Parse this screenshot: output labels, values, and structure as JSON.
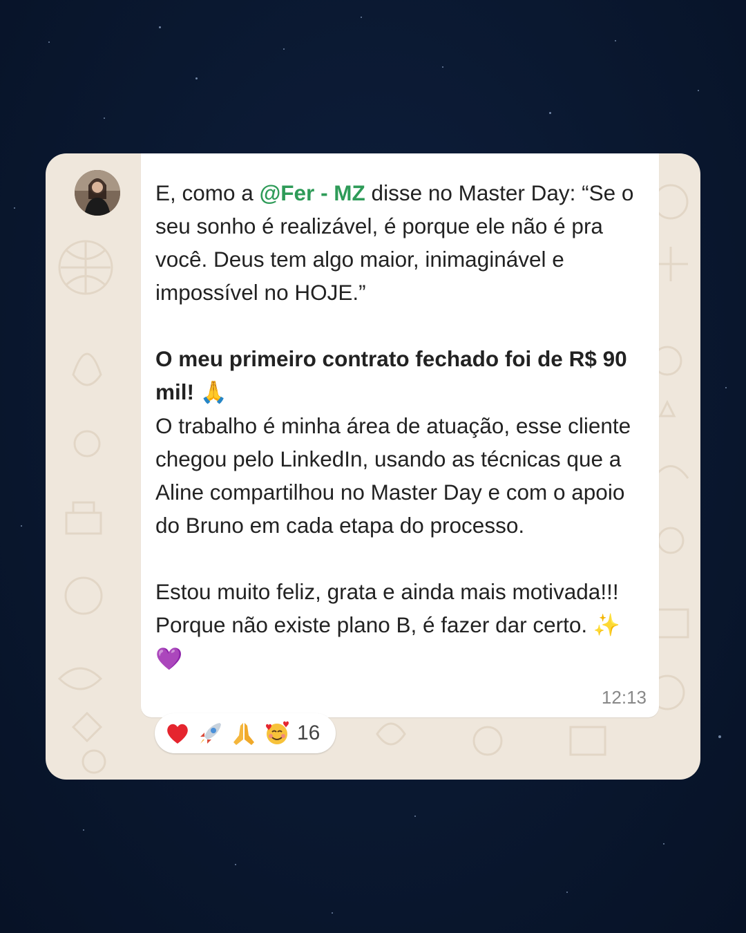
{
  "message": {
    "intro_before_mention": "E, como a ",
    "mention": "@Fer - MZ",
    "intro_after_mention": " disse no Master Day: “Se o seu sonho é realizável, é porque ele não é pra você. Deus tem algo maior, inimaginável e impossível no HOJE.”",
    "highlight": "O meu primeiro contrato fechado foi de R$ 90 mil!",
    "highlight_emoji": "🙏",
    "body": "O trabalho é minha área de atuação, esse cliente chegou pelo LinkedIn, usando as técnicas que a Aline compartilhou no Master Day e com o apoio do Bruno em cada etapa do processo.",
    "closing": "Estou muito feliz, grata e ainda mais motivada!!! Porque não existe plano B, é fazer dar certo.",
    "closing_emoji": "✨💜",
    "time": "12:13"
  },
  "reactions": {
    "emojis": [
      "heart",
      "rocket",
      "praying-hands",
      "smiling-face-with-hearts"
    ],
    "count": "16"
  },
  "colors": {
    "background": "#0a1830",
    "card": "#efe7dc",
    "bubble": "#ffffff",
    "mention": "#2e9b58",
    "text": "#222222",
    "time": "#888888"
  }
}
